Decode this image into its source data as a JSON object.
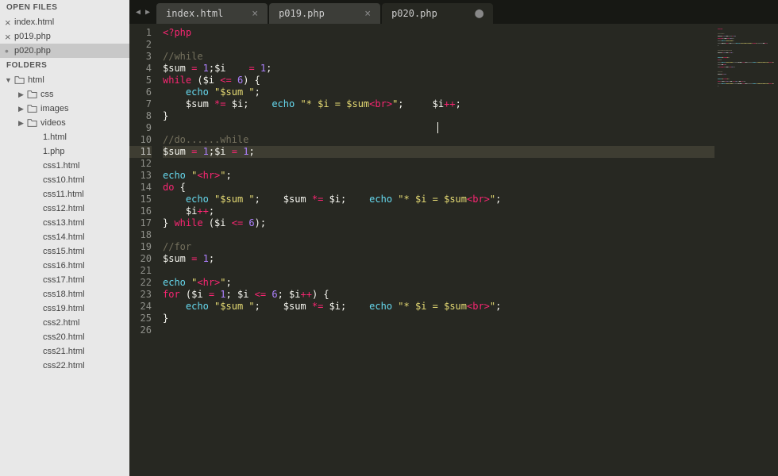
{
  "sidebar": {
    "open_files_header": "OPEN FILES",
    "folders_header": "FOLDERS",
    "open_files": [
      {
        "name": "index.html",
        "state": "close-x"
      },
      {
        "name": "p019.php",
        "state": "close-x"
      },
      {
        "name": "p020.php",
        "state": "modified",
        "active": true
      }
    ],
    "root_folder": "html",
    "subfolders": [
      "css",
      "images",
      "videos"
    ],
    "files": [
      "1.html",
      "1.php",
      "css1.html",
      "css10.html",
      "css11.html",
      "css12.html",
      "css13.html",
      "css14.html",
      "css15.html",
      "css16.html",
      "css17.html",
      "css18.html",
      "css19.html",
      "css2.html",
      "css20.html",
      "css21.html",
      "css22.html"
    ]
  },
  "tabs": [
    {
      "label": "index.html",
      "active": false,
      "dirty": false
    },
    {
      "label": "p019.php",
      "active": false,
      "dirty": false
    },
    {
      "label": "p020.php",
      "active": true,
      "dirty": true
    }
  ],
  "editor": {
    "highlighted_line": 11,
    "cursor": {
      "line": 9,
      "col": 48
    },
    "tokens": [
      [
        {
          "t": "<?",
          "c": "kw"
        },
        {
          "t": "php",
          "c": "kw"
        }
      ],
      [],
      [
        {
          "t": "//while",
          "c": "com"
        }
      ],
      [
        {
          "t": "$sum",
          "c": "var"
        },
        {
          "t": " ",
          "c": ""
        },
        {
          "t": "=",
          "c": "op"
        },
        {
          "t": " ",
          "c": ""
        },
        {
          "t": "1",
          "c": "num"
        },
        {
          "t": ";",
          "c": ""
        },
        {
          "t": "$i",
          "c": "var"
        },
        {
          "t": "    ",
          "c": ""
        },
        {
          "t": "=",
          "c": "op"
        },
        {
          "t": " ",
          "c": ""
        },
        {
          "t": "1",
          "c": "num"
        },
        {
          "t": ";",
          "c": ""
        }
      ],
      [
        {
          "t": "while",
          "c": "kw"
        },
        {
          "t": " (",
          "c": ""
        },
        {
          "t": "$i",
          "c": "var"
        },
        {
          "t": " ",
          "c": ""
        },
        {
          "t": "<=",
          "c": "op"
        },
        {
          "t": " ",
          "c": ""
        },
        {
          "t": "6",
          "c": "num"
        },
        {
          "t": ") {",
          "c": ""
        }
      ],
      [
        {
          "t": "    ",
          "c": ""
        },
        {
          "t": "echo",
          "c": "fn"
        },
        {
          "t": " ",
          "c": ""
        },
        {
          "t": "\"$sum \"",
          "c": "str"
        },
        {
          "t": ";",
          "c": ""
        }
      ],
      [
        {
          "t": "    ",
          "c": ""
        },
        {
          "t": "$sum",
          "c": "var"
        },
        {
          "t": " ",
          "c": ""
        },
        {
          "t": "*=",
          "c": "op"
        },
        {
          "t": " ",
          "c": ""
        },
        {
          "t": "$i",
          "c": "var"
        },
        {
          "t": ";    ",
          "c": ""
        },
        {
          "t": "echo",
          "c": "fn"
        },
        {
          "t": " ",
          "c": ""
        },
        {
          "t": "\"* $i = $sum",
          "c": "str"
        },
        {
          "t": "<br>",
          "c": "op"
        },
        {
          "t": "\"",
          "c": "str"
        },
        {
          "t": ";     ",
          "c": ""
        },
        {
          "t": "$i",
          "c": "var"
        },
        {
          "t": "++",
          "c": "op"
        },
        {
          "t": ";",
          "c": ""
        }
      ],
      [
        {
          "t": "}",
          "c": ""
        }
      ],
      [],
      [
        {
          "t": "//do......while",
          "c": "com"
        }
      ],
      [
        {
          "t": "$sum",
          "c": "var"
        },
        {
          "t": " ",
          "c": ""
        },
        {
          "t": "=",
          "c": "op"
        },
        {
          "t": " ",
          "c": ""
        },
        {
          "t": "1",
          "c": "num"
        },
        {
          "t": ";",
          "c": ""
        },
        {
          "t": "$i",
          "c": "var"
        },
        {
          "t": " ",
          "c": ""
        },
        {
          "t": "=",
          "c": "op"
        },
        {
          "t": " ",
          "c": ""
        },
        {
          "t": "1",
          "c": "num"
        },
        {
          "t": ";",
          "c": ""
        }
      ],
      [],
      [
        {
          "t": "echo",
          "c": "fn"
        },
        {
          "t": " ",
          "c": ""
        },
        {
          "t": "\"",
          "c": "str"
        },
        {
          "t": "<hr>",
          "c": "op"
        },
        {
          "t": "\"",
          "c": "str"
        },
        {
          "t": ";",
          "c": ""
        }
      ],
      [
        {
          "t": "do",
          "c": "kw"
        },
        {
          "t": " {",
          "c": ""
        }
      ],
      [
        {
          "t": "    ",
          "c": ""
        },
        {
          "t": "echo",
          "c": "fn"
        },
        {
          "t": " ",
          "c": ""
        },
        {
          "t": "\"$sum \"",
          "c": "str"
        },
        {
          "t": ";    ",
          "c": ""
        },
        {
          "t": "$sum",
          "c": "var"
        },
        {
          "t": " ",
          "c": ""
        },
        {
          "t": "*=",
          "c": "op"
        },
        {
          "t": " ",
          "c": ""
        },
        {
          "t": "$i",
          "c": "var"
        },
        {
          "t": ";    ",
          "c": ""
        },
        {
          "t": "echo",
          "c": "fn"
        },
        {
          "t": " ",
          "c": ""
        },
        {
          "t": "\"* $i = $sum",
          "c": "str"
        },
        {
          "t": "<br>",
          "c": "op"
        },
        {
          "t": "\"",
          "c": "str"
        },
        {
          "t": ";",
          "c": ""
        }
      ],
      [
        {
          "t": "    ",
          "c": ""
        },
        {
          "t": "$i",
          "c": "var"
        },
        {
          "t": "++",
          "c": "op"
        },
        {
          "t": ";",
          "c": ""
        }
      ],
      [
        {
          "t": "} ",
          "c": ""
        },
        {
          "t": "while",
          "c": "kw"
        },
        {
          "t": " (",
          "c": ""
        },
        {
          "t": "$i",
          "c": "var"
        },
        {
          "t": " ",
          "c": ""
        },
        {
          "t": "<=",
          "c": "op"
        },
        {
          "t": " ",
          "c": ""
        },
        {
          "t": "6",
          "c": "num"
        },
        {
          "t": ");",
          "c": ""
        }
      ],
      [],
      [
        {
          "t": "//for",
          "c": "com"
        }
      ],
      [
        {
          "t": "$sum",
          "c": "var"
        },
        {
          "t": " ",
          "c": ""
        },
        {
          "t": "=",
          "c": "op"
        },
        {
          "t": " ",
          "c": ""
        },
        {
          "t": "1",
          "c": "num"
        },
        {
          "t": ";",
          "c": ""
        }
      ],
      [],
      [
        {
          "t": "echo",
          "c": "fn"
        },
        {
          "t": " ",
          "c": ""
        },
        {
          "t": "\"",
          "c": "str"
        },
        {
          "t": "<hr>",
          "c": "op"
        },
        {
          "t": "\"",
          "c": "str"
        },
        {
          "t": ";",
          "c": ""
        }
      ],
      [
        {
          "t": "for",
          "c": "kw"
        },
        {
          "t": " (",
          "c": ""
        },
        {
          "t": "$i",
          "c": "var"
        },
        {
          "t": " ",
          "c": ""
        },
        {
          "t": "=",
          "c": "op"
        },
        {
          "t": " ",
          "c": ""
        },
        {
          "t": "1",
          "c": "num"
        },
        {
          "t": "; ",
          "c": ""
        },
        {
          "t": "$i",
          "c": "var"
        },
        {
          "t": " ",
          "c": ""
        },
        {
          "t": "<=",
          "c": "op"
        },
        {
          "t": " ",
          "c": ""
        },
        {
          "t": "6",
          "c": "num"
        },
        {
          "t": "; ",
          "c": ""
        },
        {
          "t": "$i",
          "c": "var"
        },
        {
          "t": "++",
          "c": "op"
        },
        {
          "t": ") {",
          "c": ""
        }
      ],
      [
        {
          "t": "    ",
          "c": ""
        },
        {
          "t": "echo",
          "c": "fn"
        },
        {
          "t": " ",
          "c": ""
        },
        {
          "t": "\"$sum \"",
          "c": "str"
        },
        {
          "t": ";    ",
          "c": ""
        },
        {
          "t": "$sum",
          "c": "var"
        },
        {
          "t": " ",
          "c": ""
        },
        {
          "t": "*=",
          "c": "op"
        },
        {
          "t": " ",
          "c": ""
        },
        {
          "t": "$i",
          "c": "var"
        },
        {
          "t": ";    ",
          "c": ""
        },
        {
          "t": "echo",
          "c": "fn"
        },
        {
          "t": " ",
          "c": ""
        },
        {
          "t": "\"* $i = $sum",
          "c": "str"
        },
        {
          "t": "<br>",
          "c": "op"
        },
        {
          "t": "\"",
          "c": "str"
        },
        {
          "t": ";",
          "c": ""
        }
      ],
      [
        {
          "t": "}",
          "c": ""
        }
      ],
      []
    ]
  }
}
